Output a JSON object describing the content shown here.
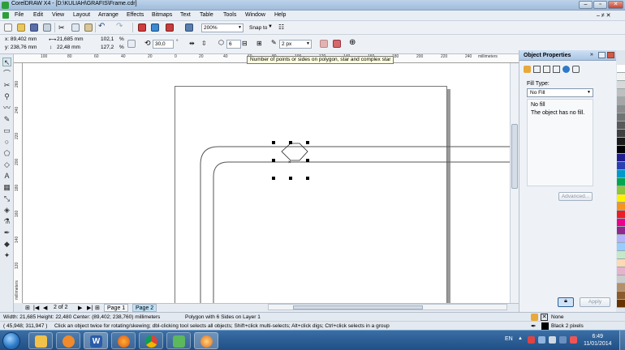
{
  "window": {
    "title": "CorelDRAW X4 - [D:\\KULIAH\\GRAFIS\\Frame.cdr]",
    "minimize": "–",
    "restore": "▫",
    "close": "✕"
  },
  "menubar": {
    "items": [
      "File",
      "Edit",
      "View",
      "Layout",
      "Arrange",
      "Effects",
      "Bitmaps",
      "Text",
      "Table",
      "Tools",
      "Window",
      "Help"
    ],
    "doc_controls": "– ≠ ✕"
  },
  "toolbar": {
    "zoom_value": "200%",
    "snap_label": "Snap to"
  },
  "property_bar": {
    "x": "x: 89,402 mm",
    "y": "y: 238,76 mm",
    "width": "21,685 mm",
    "height": "22,48 mm",
    "scale_w": "102,1",
    "scale_h": "127,2",
    "percent": "%",
    "angle": "30,0",
    "degree": "°",
    "points": "6",
    "outline": "2 px"
  },
  "tooltip": "Number of points or sides on polygon, star and complex star",
  "ruler": {
    "h_ticks": [
      "100",
      "80",
      "60",
      "40",
      "20",
      "0",
      "20",
      "40",
      "60",
      "80",
      "100",
      "120",
      "140",
      "160",
      "180",
      "200",
      "220",
      "240"
    ],
    "h_unit": "millimeters",
    "v_ticks": [
      "260",
      "240",
      "220",
      "200",
      "180",
      "160",
      "140",
      "120"
    ],
    "v_unit": "millimeters"
  },
  "page_nav": {
    "counter": "2 of 2",
    "tabs": [
      "Page 1",
      "Page 2"
    ]
  },
  "docker": {
    "title": "Object Properties",
    "fill_type_label": "Fill Type:",
    "fill_type_value": "No Fill",
    "no_fill_title": "No fill",
    "no_fill_desc": "The object has no fill.",
    "advanced_button": "Advanced...",
    "apply_button": "Apply"
  },
  "status": {
    "dimensions": "Width: 21,685  Height: 22,480  Center: (89,402; 238,760)  millimeters",
    "object_info": "Polygon with 6 Sides on Layer 1",
    "cursor": "( 45,948; 311,947 )",
    "hint": "Click an object twice for rotating/skewing; dbl-clicking tool selects all objects; Shift+click multi-selects; Alt+click digs; Ctrl+click selects in a group",
    "fill_status": "None",
    "outline_status": "Black  2 pixels"
  },
  "palette_colors": [
    "#ffffff",
    "#f2f2f2",
    "#d9d9d9",
    "#bfbfbf",
    "#a6a6a6",
    "#8c8c8c",
    "#737373",
    "#595959",
    "#404040",
    "#1a1a1a",
    "#000000",
    "#1e1e8c",
    "#2b3fb5",
    "#0099cc",
    "#00a651",
    "#8dc63f",
    "#fff200",
    "#f7941d",
    "#ed1c24",
    "#ec008c",
    "#92278f",
    "#b3b3ff",
    "#99ccff",
    "#c7e8c6",
    "#ffd9b3",
    "#e6b3cc",
    "#cccccc",
    "#b38f6b",
    "#8b5a2b",
    "#663300"
  ],
  "taskbar": {
    "language": "EN",
    "time": "6:49",
    "date": "11/01/2014"
  }
}
